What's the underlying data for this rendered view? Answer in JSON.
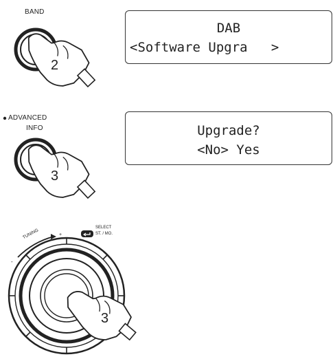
{
  "step1": {
    "button_label": "BAND",
    "press_count": "2",
    "display": {
      "line1": "DAB",
      "line2": "<Software Upgra   >"
    }
  },
  "step2": {
    "button_label_1": "ADVANCED",
    "button_label_2": "INFO",
    "press_count": "3",
    "display": {
      "line1": "Upgrade?",
      "line2": "<No> Yes"
    }
  },
  "step3": {
    "knob_label_tuning": "TUNING",
    "knob_label_select": "SELECT",
    "knob_label_stmo": "ST. / MO.",
    "minus_sign": "-",
    "plus_sign": "+",
    "press_count": "3"
  }
}
